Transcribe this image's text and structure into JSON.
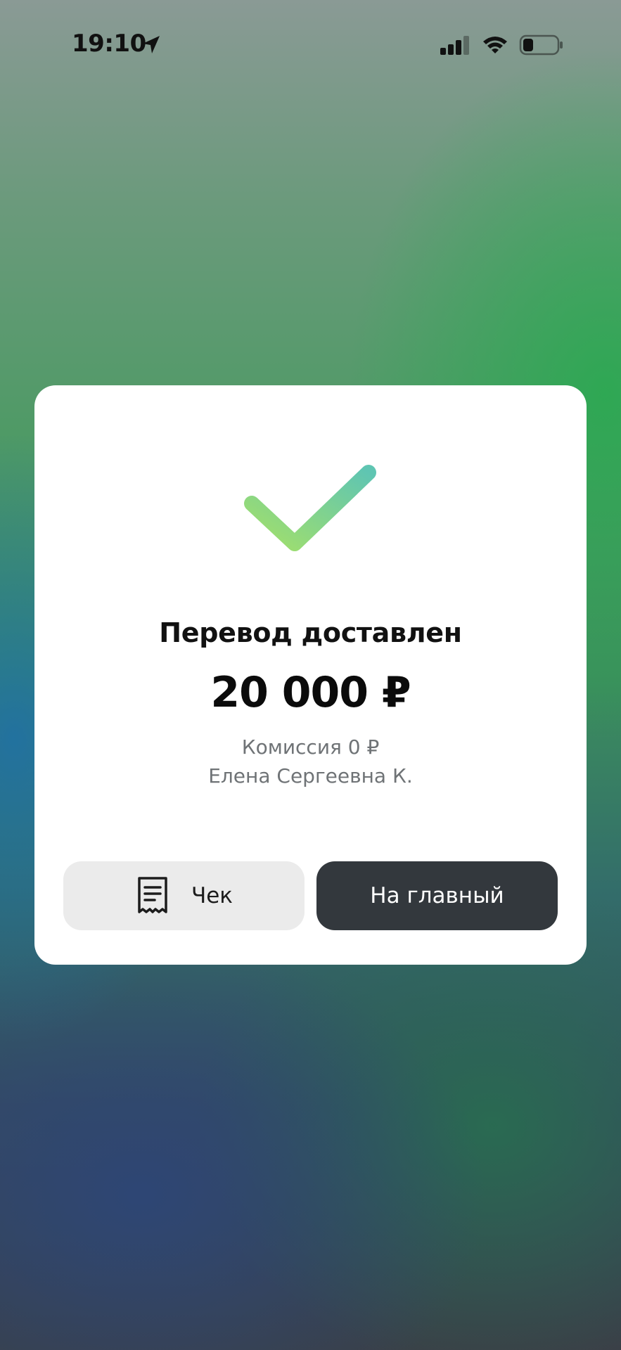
{
  "status_bar": {
    "time": "19:10",
    "location_icon": "location-arrow-icon",
    "signal_icon": "cellular-signal-icon",
    "wifi_icon": "wifi-icon",
    "battery_icon": "battery-low-icon"
  },
  "result": {
    "icon": "checkmark-icon",
    "title": "Перевод доставлен",
    "amount": "20 000 ₽",
    "commission": "Комиссия 0 ₽",
    "recipient": "Елена Сергеевна К."
  },
  "actions": {
    "receipt_label": "Чек",
    "receipt_icon": "receipt-icon",
    "home_label": "На главный"
  },
  "colors": {
    "check_gradient_start": "#a3e06a",
    "check_gradient_end": "#5fc5b2",
    "home_button": "#33383d",
    "receipt_button": "#ebebeb"
  }
}
